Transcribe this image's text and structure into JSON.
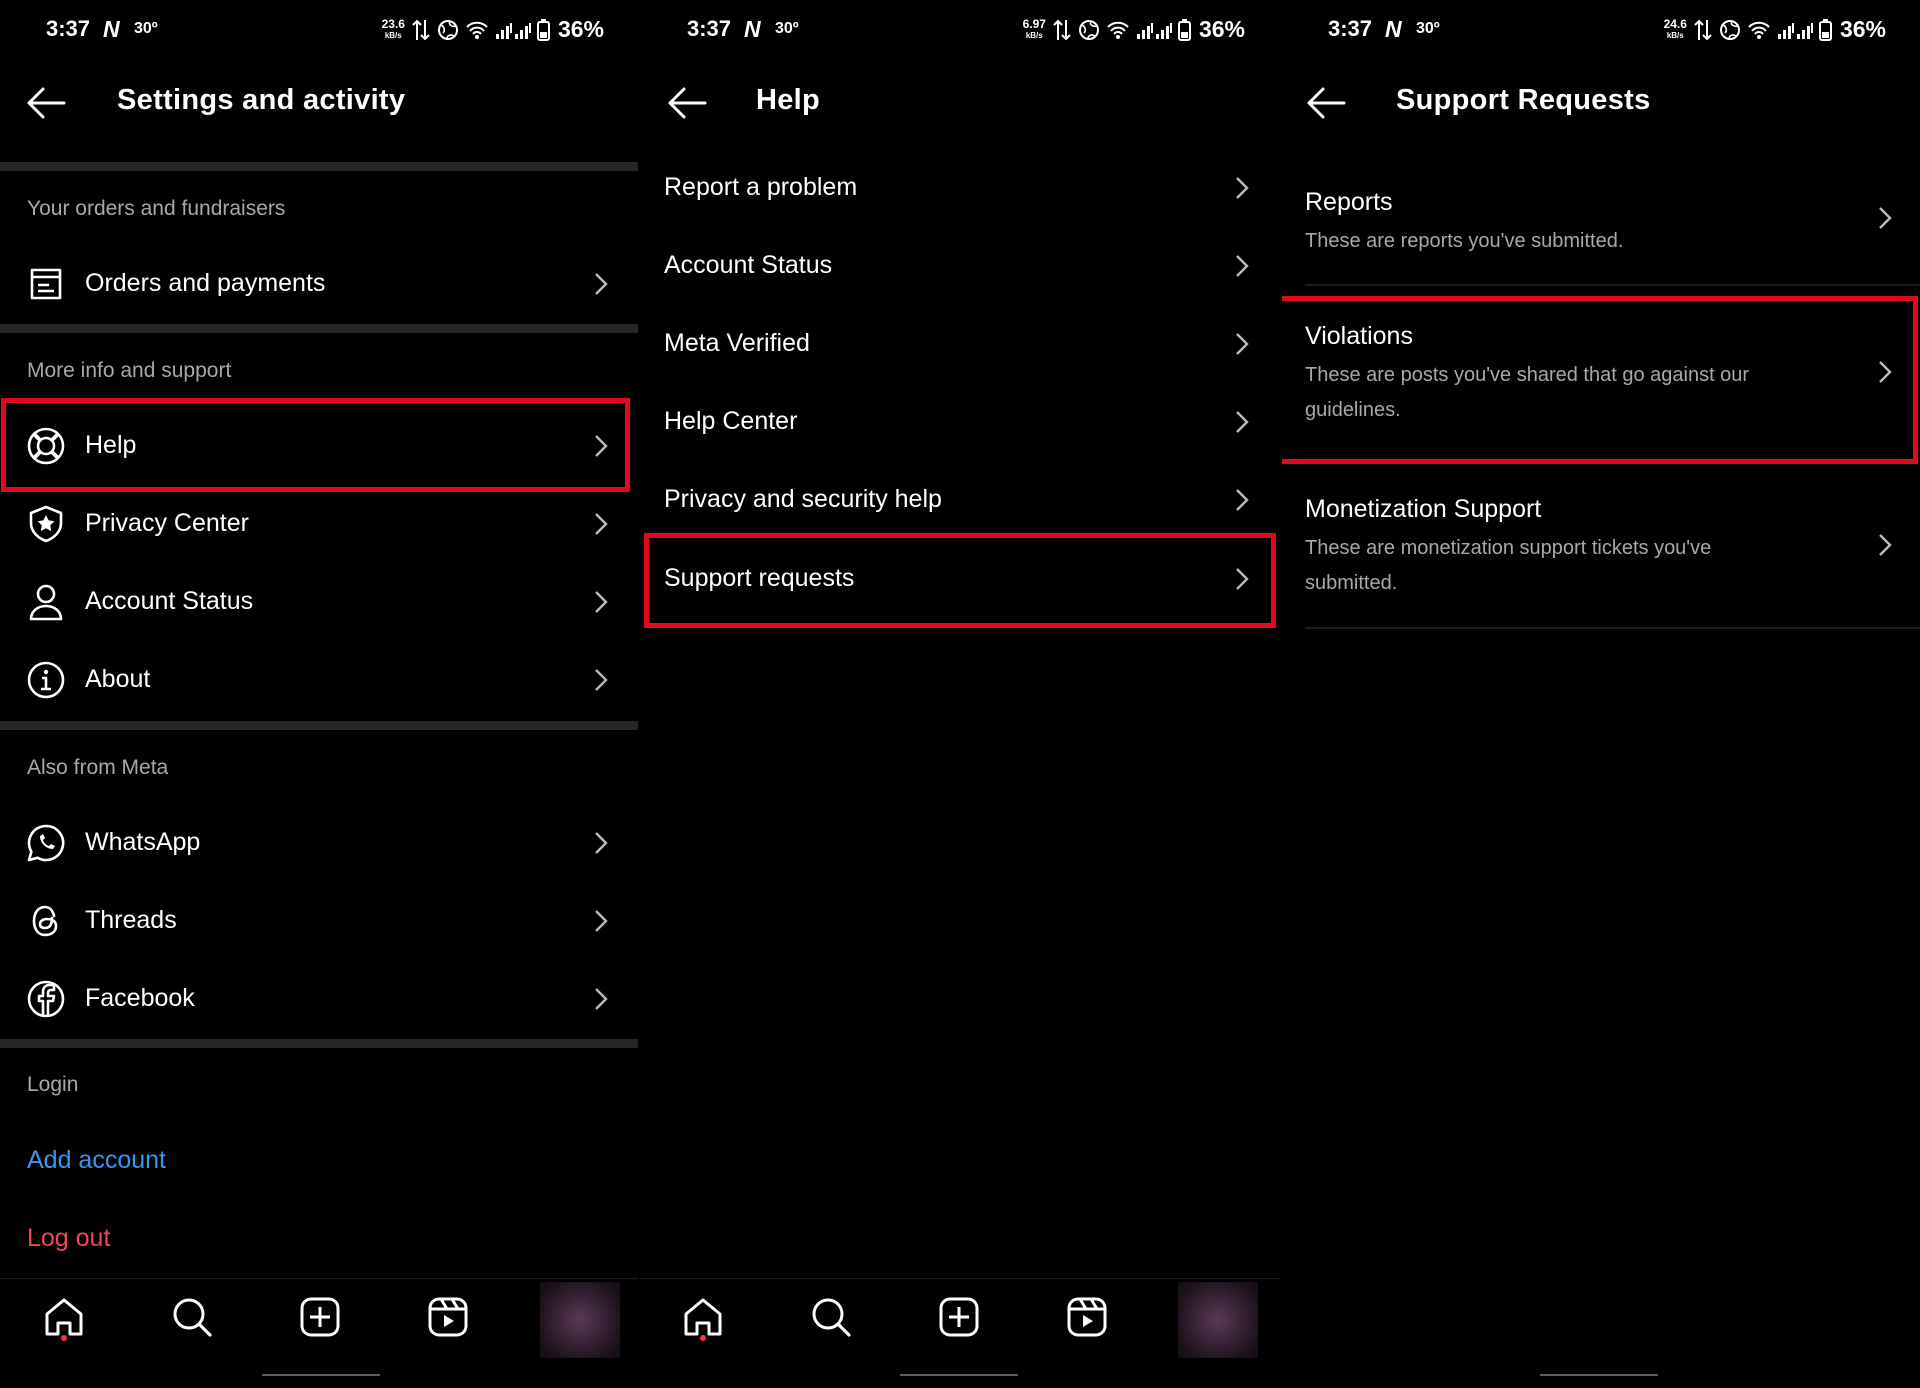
{
  "status": {
    "time": "3:37",
    "network_letter": "N",
    "temp": "30º",
    "battery": "36%",
    "speed_unit": "kB/s",
    "speeds": [
      "23.6",
      "6.97",
      "24.6"
    ]
  },
  "settings": {
    "title": "Settings and activity",
    "sections": {
      "orders": "Your orders and fundraisers",
      "more_info": "More info and support",
      "meta": "Also from Meta",
      "login": "Login"
    },
    "items": {
      "orders": "Orders and payments",
      "help": "Help",
      "privacy_center": "Privacy Center",
      "account_status": "Account Status",
      "about": "About",
      "whatsapp": "WhatsApp",
      "threads": "Threads",
      "facebook": "Facebook"
    },
    "add_account": "Add account",
    "log_out": "Log out"
  },
  "help": {
    "title": "Help",
    "items": [
      "Report a problem",
      "Account Status",
      "Meta Verified",
      "Help Center",
      "Privacy and security help",
      "Support requests"
    ]
  },
  "support": {
    "title": "Support Requests",
    "items": [
      {
        "title": "Reports",
        "desc": "These are reports you've submitted."
      },
      {
        "title": "Violations",
        "desc": "These are posts you've shared that go against our guidelines."
      },
      {
        "title": "Monetization Support",
        "desc": "These are monetization support tickets you've submitted."
      }
    ]
  },
  "colors": {
    "highlight": "#e00b1c",
    "link_blue": "#3897f0",
    "logout_red": "#ed4956",
    "secondary_text": "#a8a8a8",
    "divider": "#262626"
  }
}
